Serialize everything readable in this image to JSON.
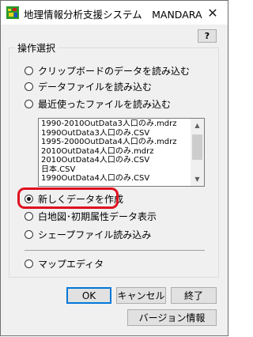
{
  "window": {
    "title": "地理情報分析支援システム　MANDARA",
    "close_glyph": "✕",
    "help_label": "?"
  },
  "group": {
    "label": "操作選択"
  },
  "options": [
    {
      "label": "クリップボードのデータを読み込む",
      "checked": false
    },
    {
      "label": "データファイルを読み込む",
      "checked": false
    },
    {
      "label": "最近使ったファイルを読み込む",
      "checked": false
    },
    {
      "label": "新しくデータを作成",
      "checked": true
    },
    {
      "label": "白地図･初期属性データ表示",
      "checked": false
    },
    {
      "label": "シェープファイル読み込み",
      "checked": false
    },
    {
      "label": "マップエディタ",
      "checked": false
    }
  ],
  "recent_files": [
    "1990-2010OutData3人口のみ.mdrz",
    "1990OutData3人口のみ.CSV",
    "1995-2000OutData4人口のみ.mdrz",
    "2010OutData4人口のみ.mdrz",
    "2010OutData4人口のみ.CSV",
    "日本.CSV",
    "1990OutData4人口のみ.CSV"
  ],
  "buttons": {
    "ok": "OK",
    "cancel": "キャンセル",
    "exit": "終了",
    "version": "バージョン情報"
  },
  "colors": {
    "highlight": "#e0101f",
    "default_button_border": "#0078d7"
  },
  "icons": {
    "app": "mandara-app-icon",
    "close": "close-icon"
  }
}
